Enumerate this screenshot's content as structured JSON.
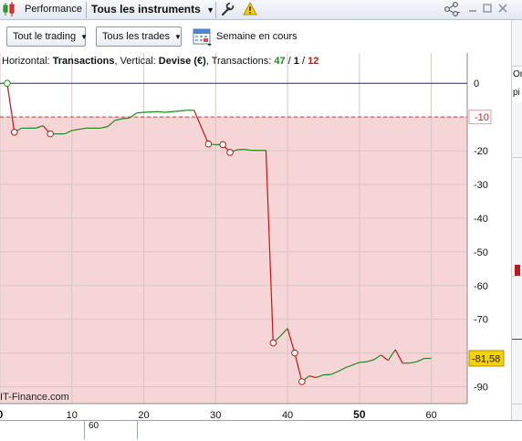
{
  "titlebar": {
    "tab_label": "Performance",
    "instrument_dropdown": "Tous les instruments"
  },
  "toolbar": {
    "trading_filter": "Tout le trading",
    "trades_filter": "Tous les trades",
    "period_label": "Semaine en cours"
  },
  "legend": {
    "prefix": "Horizontal: ",
    "horizontal_value": "Transactions",
    "mid": ", Vertical: ",
    "vertical_value": "Devise (€)",
    "suffix": ", Transactions: ",
    "count_green": "47",
    "sep1": " / ",
    "count_black": "1",
    "sep2": " / ",
    "count_red": "12"
  },
  "watermark": "IT-Finance.com",
  "badges": {
    "threshold": "-10",
    "current": "-81,58"
  },
  "right_fragments": {
    "a": "Or",
    "b": "pi"
  },
  "bottom_fragment": "60",
  "chart_data": {
    "type": "line",
    "x_axis": {
      "range": [
        0,
        65
      ],
      "ticks": [
        0,
        10,
        20,
        30,
        40,
        50,
        60
      ],
      "bold_ticks": [
        0,
        50
      ]
    },
    "y_axis": {
      "range": [
        -95,
        9
      ],
      "ticks": [
        0,
        -10,
        -20,
        -30,
        -40,
        -50,
        -60,
        -70,
        -80,
        -90
      ]
    },
    "grid": true,
    "zero_line": 0,
    "threshold_line": -10,
    "shaded_below": -10,
    "current_value": -81.58,
    "points": [
      [
        1,
        0
      ],
      [
        2,
        -14.5
      ],
      [
        3,
        -13.3
      ],
      [
        5,
        -13.3
      ],
      [
        6,
        -12.6
      ],
      [
        7,
        -15
      ],
      [
        9,
        -15
      ],
      [
        10,
        -14
      ],
      [
        12,
        -13.3
      ],
      [
        14,
        -13.3
      ],
      [
        15,
        -12.8
      ],
      [
        16,
        -11
      ],
      [
        17,
        -10.5
      ],
      [
        18,
        -10.3
      ],
      [
        19,
        -8.8
      ],
      [
        20,
        -8.6
      ],
      [
        22,
        -8.4
      ],
      [
        23,
        -8.6
      ],
      [
        24,
        -8.4
      ],
      [
        26,
        -8
      ],
      [
        27,
        -8
      ],
      [
        29,
        -18
      ],
      [
        30,
        -18.2
      ],
      [
        31,
        -18.2
      ],
      [
        32,
        -20.5
      ],
      [
        33,
        -19.7
      ],
      [
        34,
        -19.6
      ],
      [
        35,
        -19.9
      ],
      [
        37,
        -19.9
      ],
      [
        38,
        -77
      ],
      [
        39,
        -75
      ],
      [
        40,
        -72.7
      ],
      [
        41,
        -80
      ],
      [
        42,
        -88.5
      ],
      [
        43,
        -86.8
      ],
      [
        44,
        -87.3
      ],
      [
        45,
        -86.5
      ],
      [
        46,
        -86.4
      ],
      [
        47,
        -85.5
      ],
      [
        48,
        -84.4
      ],
      [
        50,
        -82.8
      ],
      [
        51,
        -82.6
      ],
      [
        52,
        -82
      ],
      [
        53,
        -80.6
      ],
      [
        54,
        -82.2
      ],
      [
        55,
        -79
      ],
      [
        56,
        -83
      ],
      [
        57,
        -83
      ],
      [
        58,
        -82.6
      ],
      [
        59,
        -81.6
      ],
      [
        60,
        -81.6
      ]
    ],
    "markers": [
      1,
      2,
      7,
      29,
      31,
      32,
      38,
      41,
      42
    ]
  }
}
